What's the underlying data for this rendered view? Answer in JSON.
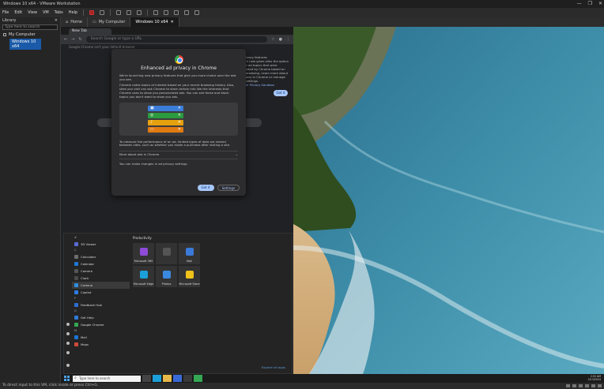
{
  "window": {
    "title": "Windows 10 x64 - VMware Workstation",
    "controls": [
      "—",
      "❐",
      "✕"
    ]
  },
  "menu": {
    "items": [
      "File",
      "Edit",
      "View",
      "VM",
      "Tabs",
      "Help"
    ]
  },
  "library": {
    "title": "Library",
    "close": "✕",
    "search_placeholder": "Type here to search",
    "tree": [
      {
        "label": "My Computer"
      },
      {
        "label": "Windows 10 x64",
        "selected": true
      }
    ]
  },
  "vm_tabs": [
    {
      "label": "Home",
      "active": false
    },
    {
      "label": "My Computer",
      "active": false
    },
    {
      "label": "Windows 10 x64",
      "active": true
    }
  ],
  "chrome": {
    "tab_label": "New Tab",
    "omnibox_placeholder": "Search Google or type a URL",
    "bookmarks_hint": "Google Chrome isn't your default browser",
    "side_notice": {
      "title": "ad privacy features",
      "text": "Search now gives sites the option to use ad topics that were estimated by Chrome based on your browsing. Learn more about ad topics in Chrome or manage your settings.",
      "link": "Google Privacy Sandbox",
      "button": "Got it"
    }
  },
  "dialog": {
    "title": "Enhanced ad privacy in Chrome",
    "para1": "We're launching new privacy features that give you more choice over the ads you see.",
    "para2": "Chrome notes topics of interest based on your recent browsing history. Also, sites you visit can ask Chrome to store certain info like the interests that Chrome uses to show you personalized ads. You can see these and block topics you don't want to show you ads.",
    "para3": "To measure the performance of an ad, limited types of data are shared between sites, such as whether you made a purchase after visiting a site.",
    "more_label": "More about ads in Chrome",
    "footer": "You can make changes in ad privacy settings.",
    "btn_primary": "Got it",
    "btn_secondary": "Settings",
    "chip_colors": [
      "#3b7dd8",
      "#2c9a3e",
      "#e6a10f",
      "#e07b12"
    ]
  },
  "start_menu": {
    "list": [
      {
        "type": "letter",
        "label": "#"
      },
      {
        "type": "app",
        "label": "3D Viewer",
        "icon_color": "#5b6bd6"
      },
      {
        "type": "letter",
        "label": "C"
      },
      {
        "type": "app",
        "label": "Calculator",
        "icon_color": "#6d6d6d"
      },
      {
        "type": "app",
        "label": "Calendar",
        "icon_color": "#1e78d6"
      },
      {
        "type": "app",
        "label": "Camera",
        "icon_color": "#555555"
      },
      {
        "type": "app",
        "label": "Clock",
        "icon_color": "#4a4a4a"
      },
      {
        "type": "app",
        "label": "Cortana",
        "icon_color": "#2e8fe0",
        "highlight": true
      },
      {
        "type": "app",
        "label": "Copilot",
        "icon_color": "#2d7de0"
      },
      {
        "type": "letter",
        "label": "F"
      },
      {
        "type": "app",
        "label": "Feedback Hub",
        "icon_color": "#2e6fd0"
      },
      {
        "type": "letter",
        "label": "G"
      },
      {
        "type": "app",
        "label": "Get Help",
        "icon_color": "#2f7ad8"
      },
      {
        "type": "app",
        "label": "Google Chrome",
        "icon_color": "#34a853"
      },
      {
        "type": "letter",
        "label": "M"
      },
      {
        "type": "app",
        "label": "Mail",
        "icon_color": "#1a73d6"
      },
      {
        "type": "app",
        "label": "Maps",
        "icon_color": "#d04a3a"
      }
    ],
    "group_title": "Productivity",
    "tiles": [
      {
        "label": "Microsoft 365",
        "icon_color": "#8e4ad8"
      },
      {
        "label": "",
        "icon_color": "#555555"
      },
      {
        "label": "Mail",
        "icon_color": "#3a7ad8"
      },
      {
        "label": "Microsoft Edge",
        "icon_color": "#1b9fd8"
      },
      {
        "label": "Photos",
        "icon_color": "#3a8ae0"
      },
      {
        "label": "Microsoft Store",
        "icon_color": "#f0c21a"
      }
    ],
    "footer_link": "Explore all apps"
  },
  "taskbar": {
    "search_placeholder": "Type here to search",
    "tray_time": "2:52 AM",
    "tray_date": "2/13/2024"
  },
  "status_bar": {
    "text": "To direct input to this VM, click inside or press Ctrl+G."
  }
}
